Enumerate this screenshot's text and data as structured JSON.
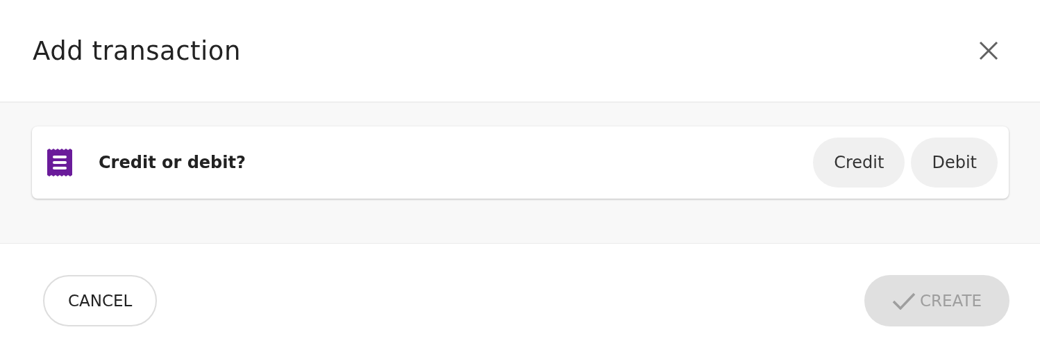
{
  "dialog": {
    "title": "Add transaction"
  },
  "question": {
    "label": "Credit or debit?"
  },
  "options": [
    {
      "label": "Credit",
      "selected": false
    },
    {
      "label": "Debit",
      "selected": false
    }
  ],
  "footer": {
    "cancel": "CANCEL",
    "create": {
      "label": "CREATE",
      "disabled": true
    }
  }
}
